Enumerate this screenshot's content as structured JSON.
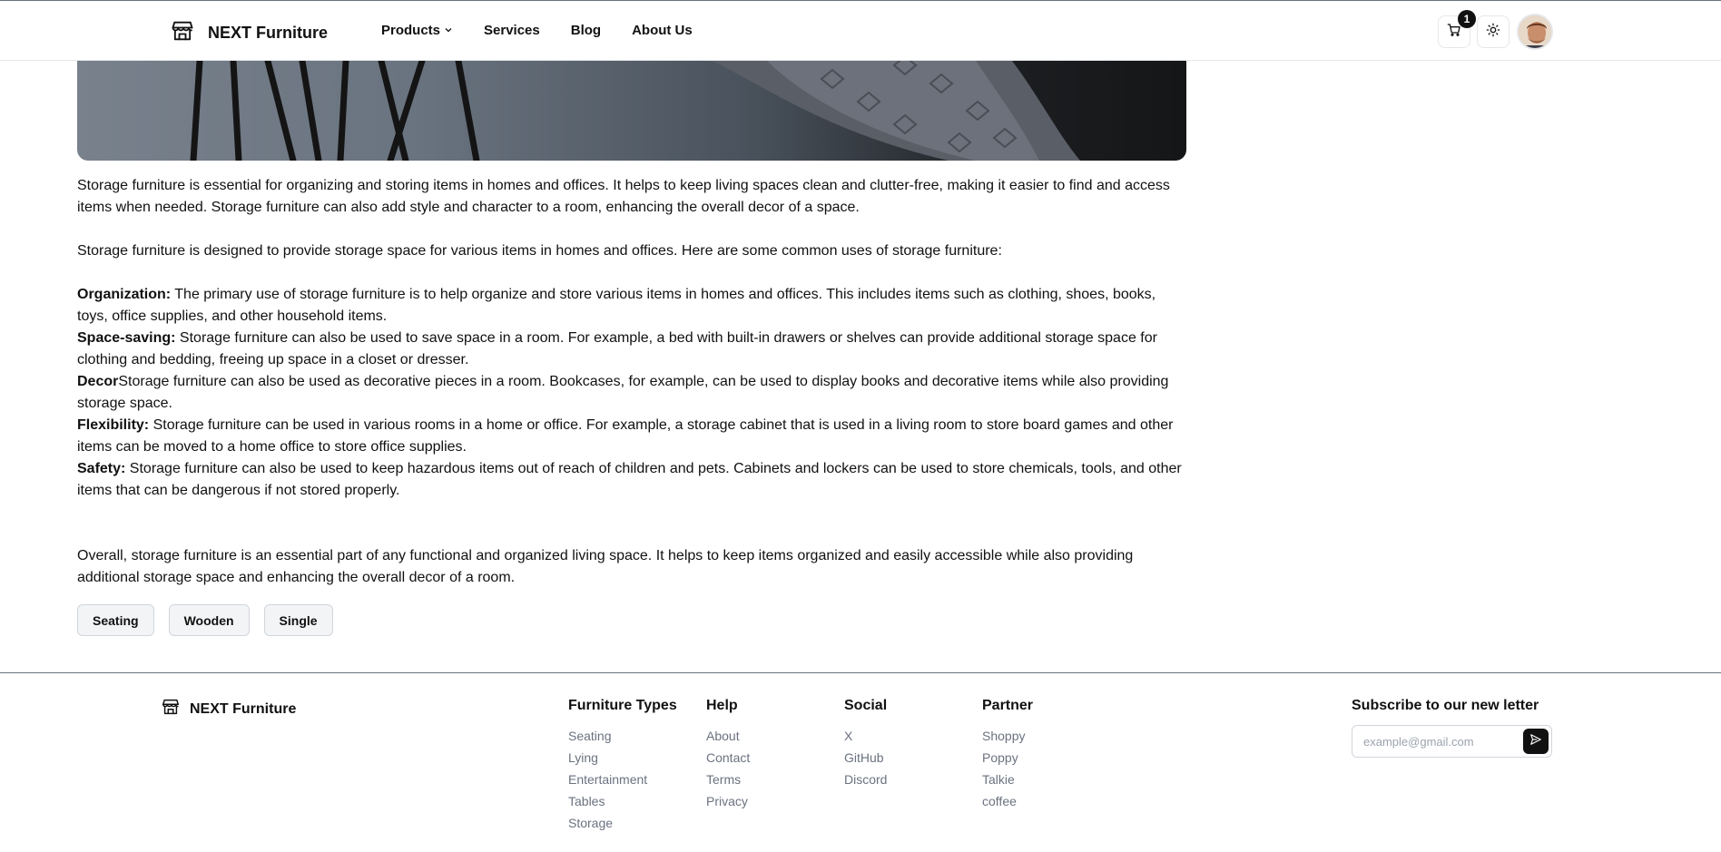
{
  "header": {
    "brand": "NEXT Furniture",
    "nav": [
      {
        "label": "Products",
        "has_dropdown": true
      },
      {
        "label": "Services"
      },
      {
        "label": "Blog"
      },
      {
        "label": "About Us"
      }
    ],
    "cart_count": "1"
  },
  "article": {
    "intro": "Storage furniture is essential for organizing and storing items in homes and offices. It helps to keep living spaces clean and clutter-free, making it easier to find and access items when needed. Storage furniture can also add style and character to a room, enhancing the overall decor of a space.",
    "uses_intro": "Storage furniture is designed to provide storage space for various items in homes and offices. Here are some common uses of storage furniture:",
    "uses": [
      {
        "term": "Organization:",
        "text": " The primary use of storage furniture is to help organize and store various items in homes and offices. This includes items such as clothing, shoes, books, toys, office supplies, and other household items."
      },
      {
        "term": "Space-saving:",
        "text": " Storage furniture can also be used to save space in a room. For example, a bed with built-in drawers or shelves can provide additional storage space for clothing and bedding, freeing up space in a closet or dresser."
      },
      {
        "term": "Decor",
        "text": "Storage furniture can also be used as decorative pieces in a room. Bookcases, for example, can be used to display books and decorative items while also providing storage space."
      },
      {
        "term": "Flexibility:",
        "text": " Storage furniture can be used in various rooms in a home or office. For example, a storage cabinet that is used in a living room to store board games and other items can be moved to a home office to store office supplies."
      },
      {
        "term": "Safety:",
        "text": " Storage furniture can also be used to keep hazardous items out of reach of children and pets. Cabinets and lockers can be used to store chemicals, tools, and other items that can be dangerous if not stored properly."
      }
    ],
    "conclusion": "Overall, storage furniture is an essential part of any functional and organized living space. It helps to keep items organized and easily accessible while also providing additional storage space and enhancing the overall decor of a room."
  },
  "tags": [
    "Seating",
    "Wooden",
    "Single"
  ],
  "footer": {
    "brand": "NEXT Furniture",
    "columns": [
      {
        "title": "Furniture Types",
        "links": [
          "Seating",
          "Lying",
          "Entertainment",
          "Tables",
          "Storage"
        ]
      },
      {
        "title": "Help",
        "links": [
          "About",
          "Contact",
          "Terms",
          "Privacy"
        ]
      },
      {
        "title": "Social",
        "links": [
          "X",
          "GitHub",
          "Discord"
        ]
      },
      {
        "title": "Partner",
        "links": [
          "Shoppy",
          "Poppy",
          "Talkie",
          "coffee"
        ]
      }
    ],
    "subscribe": {
      "title": "Subscribe to our new letter",
      "placeholder": "example@gmail.com"
    }
  }
}
